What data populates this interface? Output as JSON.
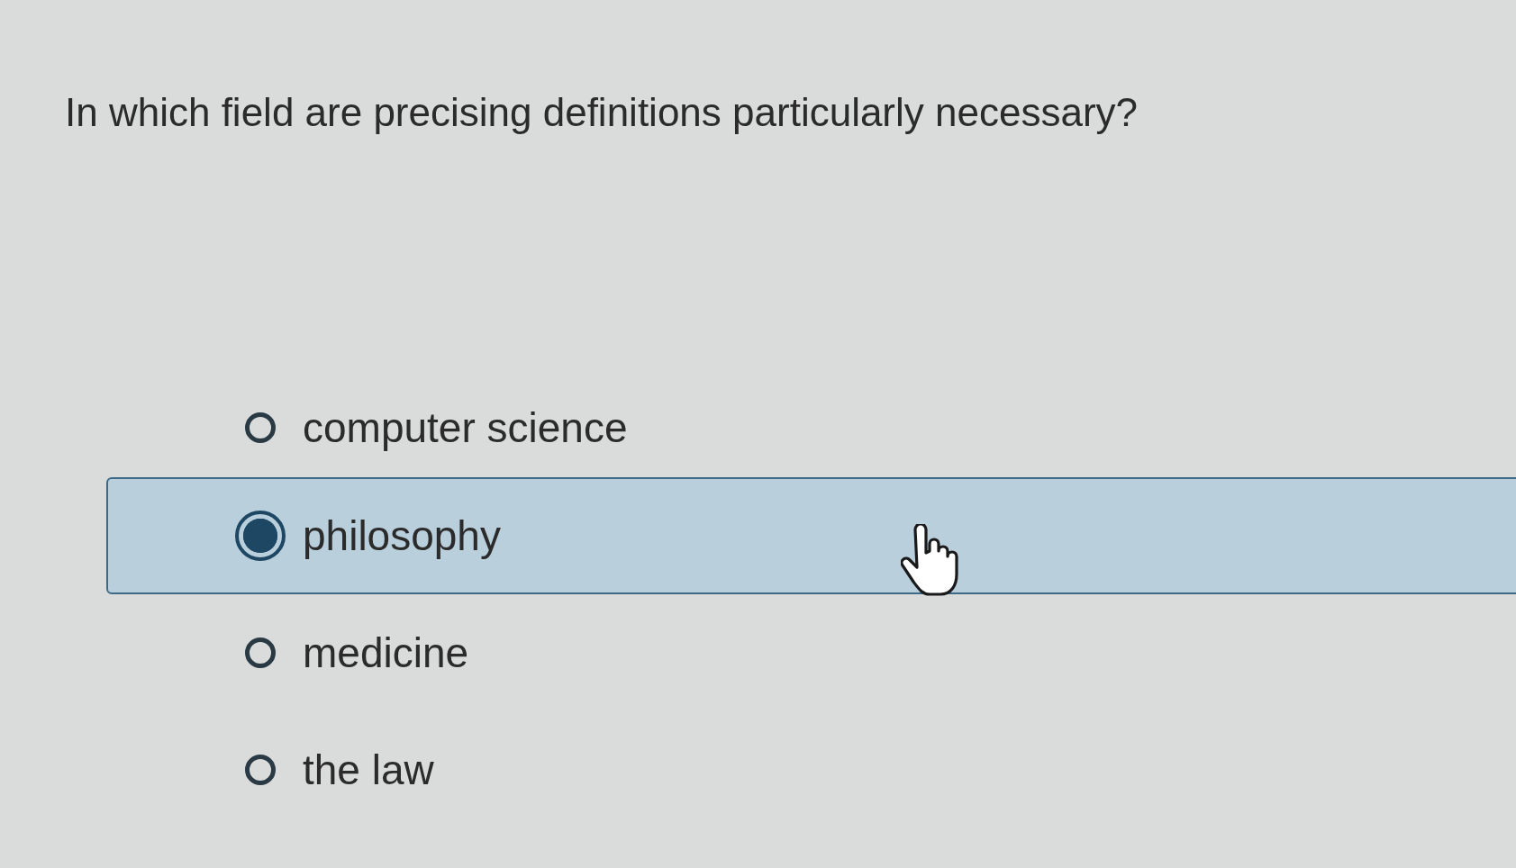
{
  "question": "In which field are precising definitions particularly necessary?",
  "options": [
    {
      "label": "computer science",
      "selected": false
    },
    {
      "label": "philosophy",
      "selected": true
    },
    {
      "label": "medicine",
      "selected": false
    },
    {
      "label": "the law",
      "selected": false
    }
  ]
}
